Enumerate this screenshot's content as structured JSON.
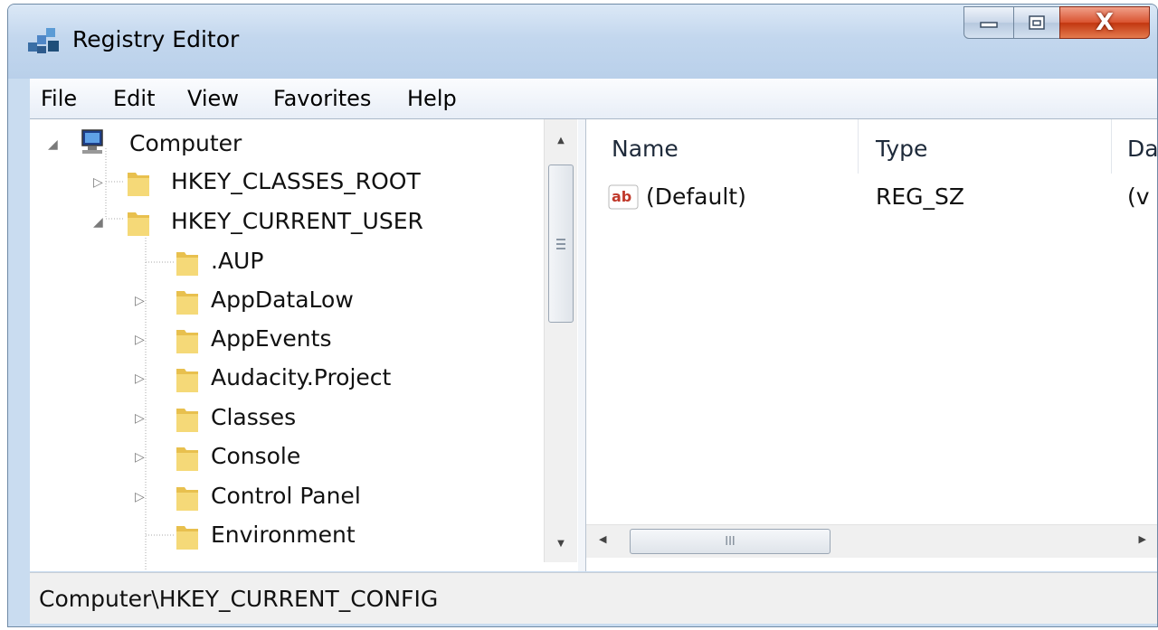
{
  "window": {
    "title": "Registry Editor",
    "buttons": {
      "minimize": "minimize",
      "maximize": "maximize",
      "close": "X"
    }
  },
  "menu": [
    "File",
    "Edit",
    "View",
    "Favorites",
    "Help"
  ],
  "tree": {
    "root": "Computer",
    "hives": [
      {
        "label": "HKEY_CLASSES_ROOT",
        "expanded": false
      },
      {
        "label": "HKEY_CURRENT_USER",
        "expanded": true
      }
    ],
    "children": [
      {
        "label": ".AUP",
        "has_children": false
      },
      {
        "label": "AppDataLow",
        "has_children": true
      },
      {
        "label": "AppEvents",
        "has_children": true
      },
      {
        "label": "Audacity.Project",
        "has_children": true
      },
      {
        "label": "Classes",
        "has_children": true
      },
      {
        "label": "Console",
        "has_children": true
      },
      {
        "label": "Control Panel",
        "has_children": true
      },
      {
        "label": "Environment",
        "has_children": false
      }
    ]
  },
  "list": {
    "columns": [
      "Name",
      "Type",
      "Da"
    ],
    "rows": [
      {
        "icon": "string-value-icon",
        "name": "(Default)",
        "type": "REG_SZ",
        "data": "(v"
      }
    ],
    "hscroll_label": "III"
  },
  "status": {
    "path": "Computer\\HKEY_CURRENT_CONFIG"
  },
  "colors": {
    "titlebar": "#c3d7ee",
    "close": "#d9532f",
    "folder": "#f3d36a"
  }
}
